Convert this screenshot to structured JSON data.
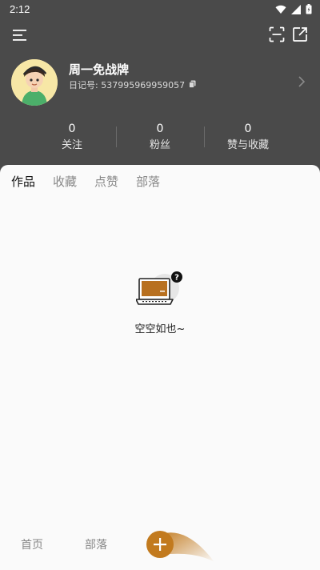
{
  "status_bar": {
    "time": "2:12"
  },
  "icons": {
    "wifi": "wifi-icon",
    "signal": "signal-icon",
    "battery": "battery-icon",
    "menu": "menu-icon",
    "scan": "scan-icon",
    "share": "share-icon",
    "copy": "copy-icon",
    "chevron": "chevron-right-icon",
    "add": "plus-icon"
  },
  "profile": {
    "name": "周一免战牌",
    "uid": "日记号: 537995969959057"
  },
  "stats": [
    {
      "value": "0",
      "label": "关注"
    },
    {
      "value": "0",
      "label": "粉丝"
    },
    {
      "value": "0",
      "label": "赞与收藏"
    }
  ],
  "tabs": [
    {
      "label": "作品"
    },
    {
      "label": "收藏"
    },
    {
      "label": "点赞"
    },
    {
      "label": "部落"
    }
  ],
  "empty_state": {
    "text": "空空如也~"
  },
  "bottom_nav": [
    {
      "label": "首页"
    },
    {
      "label": "部落"
    }
  ],
  "colors": {
    "header_bg": "#4a4a4a",
    "accent": "#c27a1e",
    "content_bg": "#fafafa"
  }
}
